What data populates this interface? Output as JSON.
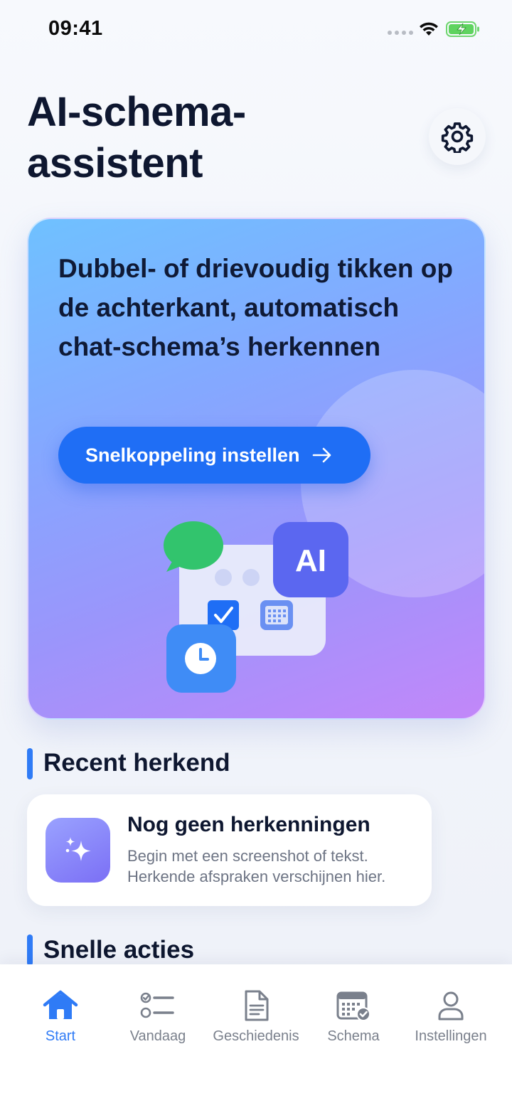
{
  "status_bar": {
    "time": "09:41"
  },
  "header": {
    "title": "AI-schema-assistent",
    "settings_icon": "gear-icon"
  },
  "hero": {
    "title": "Dubbel- of drievoudig tikken op de achterkant, automatisch chat-schema’s herkennen",
    "button_label": "Snelkoppeling instellen",
    "button_icon": "arrow-right-icon",
    "badge_text": "AI",
    "colors": {
      "button": "#1f6ef5",
      "gradient_start": "#6fc1ff",
      "gradient_end": "#c287f9"
    }
  },
  "recent": {
    "section_title": "Recent herkend",
    "empty_title": "Nog geen herkenningen",
    "empty_subtitle": "Begin met een screenshot of tekst. Herkende afspraken verschijnen hier.",
    "empty_icon": "sparkles-icon"
  },
  "quick_actions": {
    "section_title": "Snelle acties"
  },
  "tab_bar": {
    "active_color": "#2f7bf6",
    "items": [
      {
        "label": "Start",
        "icon": "home-icon",
        "active": true
      },
      {
        "label": "Vandaag",
        "icon": "checklist-icon",
        "active": false
      },
      {
        "label": "Geschiedenis",
        "icon": "document-icon",
        "active": false
      },
      {
        "label": "Schema",
        "icon": "calendar-check-icon",
        "active": false
      },
      {
        "label": "Instellingen",
        "icon": "person-icon",
        "active": false
      }
    ]
  }
}
